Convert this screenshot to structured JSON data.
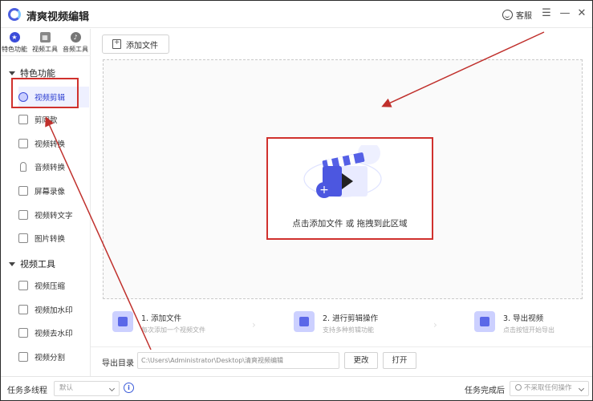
{
  "app": {
    "title": "清爽视频编辑"
  },
  "titlebar": {
    "support_label": "客服",
    "menu_icon": "menu-icon",
    "minimize_icon": "minimize-icon",
    "close_icon": "close-icon"
  },
  "top_tabs": [
    {
      "label": "特色功能",
      "icon": "star-icon",
      "active": true
    },
    {
      "label": "视频工具",
      "icon": "film-icon",
      "active": false
    },
    {
      "label": "音频工具",
      "icon": "music-icon",
      "active": false
    }
  ],
  "groups": {
    "featured": {
      "label": "特色功能",
      "items": [
        "视频剪辑",
        "剪同款",
        "视频转换",
        "音频转换",
        "屏幕录像",
        "视频转文字",
        "图片转换"
      ]
    },
    "video_tools": {
      "label": "视频工具",
      "items": [
        "视频压缩",
        "视频加水印",
        "视频去水印",
        "视频分割"
      ]
    }
  },
  "main": {
    "add_file_label": "添加文件",
    "dropzone_text": "点击添加文件 或 拖拽到此区域"
  },
  "steps": [
    {
      "title": "1. 添加文件",
      "desc": "每次添加一个视频文件"
    },
    {
      "title": "2. 进行剪辑操作",
      "desc": "支持多种剪辑功能"
    },
    {
      "title": "3. 导出视频",
      "desc": "点击按钮开始导出"
    }
  ],
  "export": {
    "label": "导出目录",
    "path": "C:\\Users\\Administrator\\Desktop\\清爽视频编辑",
    "change_label": "更改",
    "open_label": "打开"
  },
  "statusbar": {
    "multithread_label": "任务多线程",
    "multithread_value": "默认",
    "on_complete_label": "任务完成后",
    "on_complete_value": "不采取任何操作"
  },
  "colors": {
    "accent": "#3b4cd9",
    "annotation_red": "#d0312d"
  }
}
